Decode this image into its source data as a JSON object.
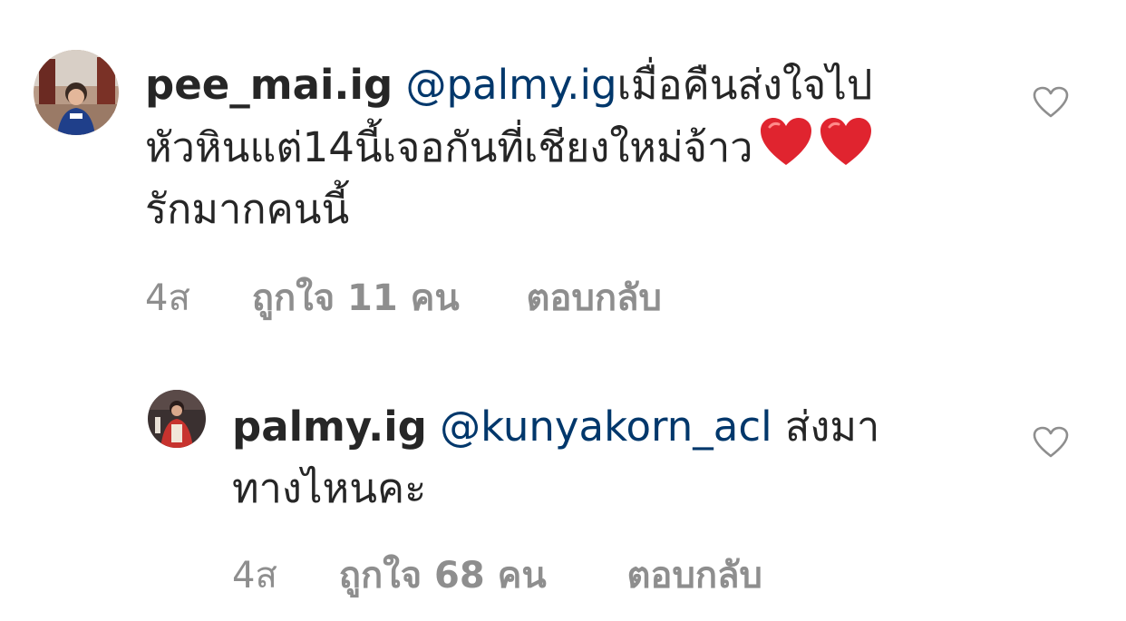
{
  "comments": [
    {
      "username": "pee_mai.ig",
      "mention": "@palmy.ig",
      "text_line1": "เมื่อคืนส่งใจไป",
      "text_line2": "หัวหินแต่14นี้เจอกันที่เชียงใหม่จ้าว",
      "text_line3": "รักมากคนนี้",
      "emoji": [
        "red-heart",
        "red-heart"
      ],
      "time": "4ส",
      "likes": "ถูกใจ 11 คน",
      "reply": "ตอบกลับ",
      "like_icon": "heart-outline-icon"
    },
    {
      "username": "palmy.ig",
      "mention": "@kunyakorn_acl",
      "text_line1": "ส่งมา",
      "text_line2": "ทางไหนคะ",
      "time": "4ส",
      "likes": "ถูกใจ 68 คน",
      "reply": "ตอบกลับ",
      "like_icon": "heart-outline-icon"
    }
  ],
  "colors": {
    "text": "#262626",
    "mention": "#00376b",
    "meta": "#8e8e8e",
    "heart_icon": "#8e8e8e",
    "emoji_heart": "#e0242f"
  }
}
